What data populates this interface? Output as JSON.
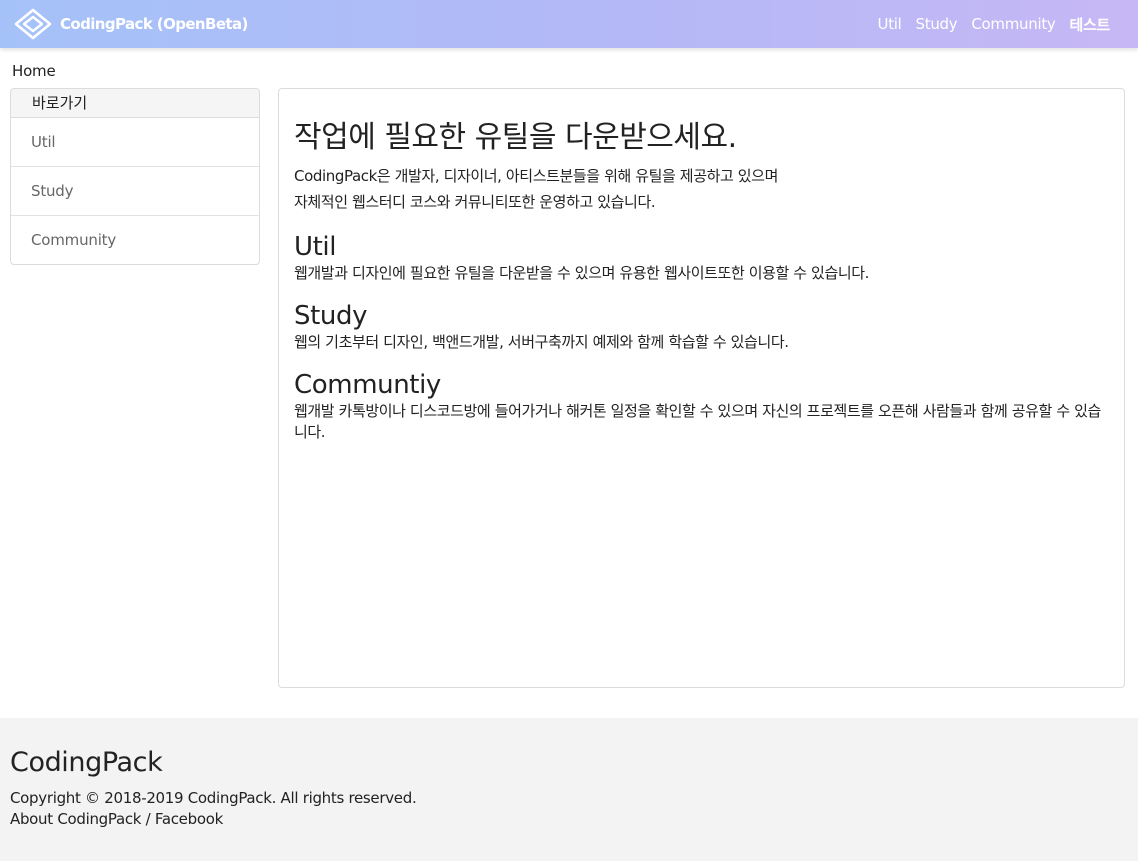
{
  "header": {
    "brand": "CodingPack (OpenBeta)",
    "logo_icon": "diamond-logo-icon",
    "nav": [
      {
        "label": "Util",
        "active": false
      },
      {
        "label": "Study",
        "active": false
      },
      {
        "label": "Community",
        "active": false
      },
      {
        "label": "테스트",
        "active": true
      }
    ]
  },
  "breadcrumb": "Home",
  "sidebar": {
    "title": "바로가기",
    "items": [
      {
        "label": "Util"
      },
      {
        "label": "Study"
      },
      {
        "label": "Community"
      }
    ]
  },
  "main": {
    "title": "작업에 필요한 유틸을 다운받으세요.",
    "intro": [
      "CodingPack은 개발자, 디자이너, 아티스트분들을 위해 유틸을 제공하고 있으며",
      "자체적인 웹스터디 코스와 커뮤니티또한 운영하고 있습니다."
    ],
    "sections": [
      {
        "heading": "Util",
        "text": "웹개발과 디자인에 필요한 유틸을 다운받을 수 있으며 유용한 웹사이트또한 이용할 수 있습니다."
      },
      {
        "heading": "Study",
        "text": "웹의 기초부터 디자인, 백앤드개발, 서버구축까지 예제와 함께 학습할 수 있습니다."
      },
      {
        "heading": "Communtiy",
        "text": "웹개발 카톡방이나 디스코드방에 들어가거나 해커톤 일정을 확인할 수 있으며 자신의 프로젝트를 오픈해 사람들과 함께 공유할 수 있습니다."
      }
    ]
  },
  "footer": {
    "brand": "CodingPack",
    "copyright": "Copyright © 2018-2019 CodingPack. All rights reserved.",
    "about_link": "About CodingPack",
    "separator": " / ",
    "facebook_link": "Facebook"
  },
  "colors": {
    "navbar_gradient_start": "#a5c2f8",
    "navbar_gradient_end": "#c7b7f5",
    "footer_bg": "#f3f3f3",
    "border": "#dcdcdc"
  }
}
